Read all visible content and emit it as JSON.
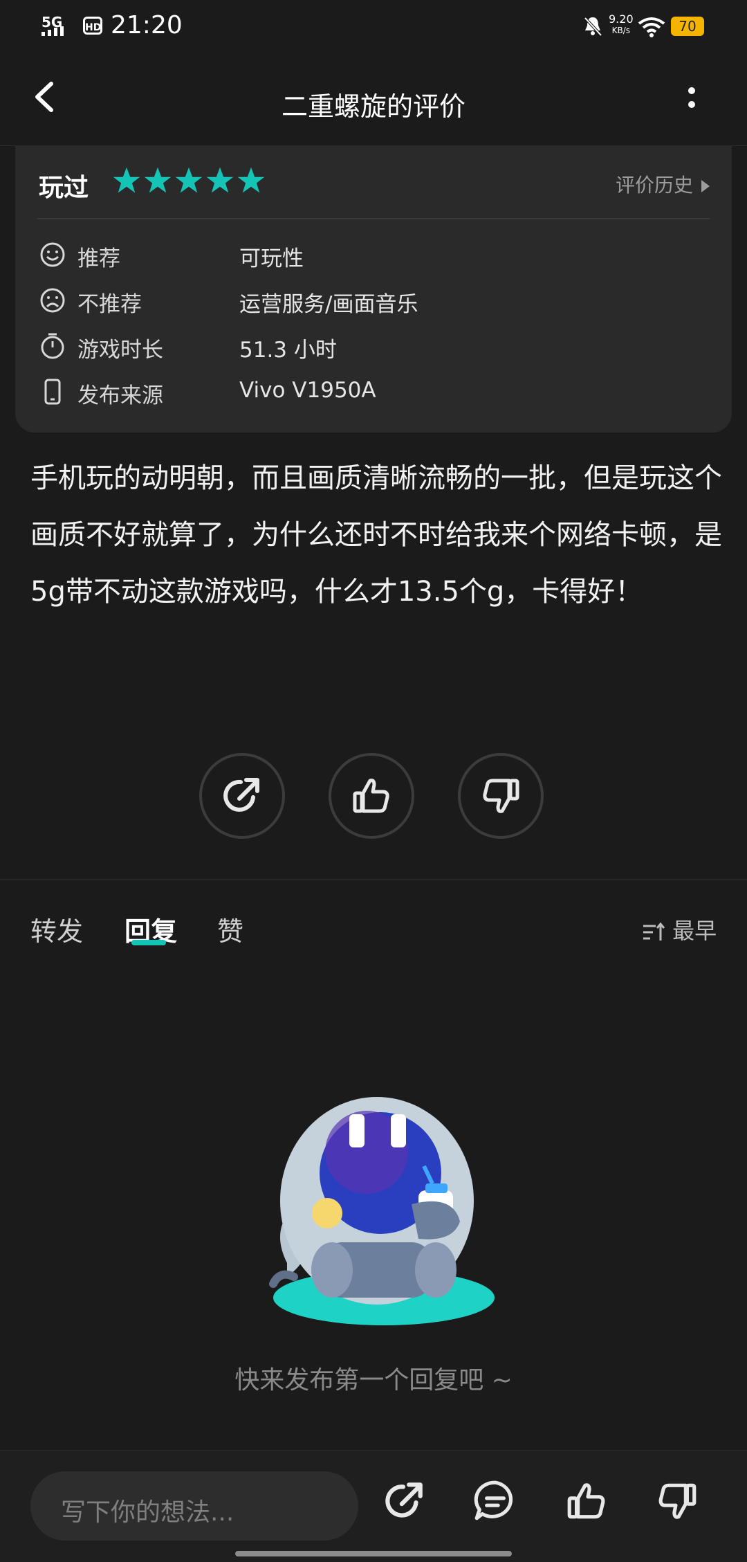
{
  "status_bar": {
    "network": "5G",
    "hd": "HD",
    "time": "21:20",
    "speed_value": "9.20",
    "speed_unit": "KB/s",
    "battery": "70"
  },
  "header": {
    "title": "二重螺旋的评价"
  },
  "card": {
    "played_label": "玩过",
    "rating": 5,
    "history_label": "评价历史",
    "rows": [
      {
        "label": "推荐",
        "value": "可玩性",
        "icon": "smile-icon"
      },
      {
        "label": "不推荐",
        "value": "运营服务/画面音乐",
        "icon": "frown-icon"
      },
      {
        "label": "游戏时长",
        "value": "51.3  小时",
        "icon": "timer-icon"
      },
      {
        "label": "发布来源",
        "value": "Vivo  V1950A",
        "icon": "phone-icon"
      }
    ]
  },
  "review": {
    "text": "手机玩的动明朝，而且画质清晰流畅的一批，但是玩这个画质不好就算了，为什么还时不时给我来个网络卡顿，是5g带不动这款游戏吗，什么才13.5个g，卡得好！"
  },
  "tabs": {
    "items": [
      "转发",
      "回复",
      "赞"
    ],
    "active": "回复",
    "sort_label": "最早"
  },
  "empty_state": {
    "text": "快来发布第一个回复吧 ~"
  },
  "bottom_bar": {
    "input_placeholder": "写下你的想法..."
  },
  "colors": {
    "background": "#1b1b1b",
    "card": "#2a2a2a",
    "accent": "#14c4b6",
    "battery": "#f5b400"
  }
}
